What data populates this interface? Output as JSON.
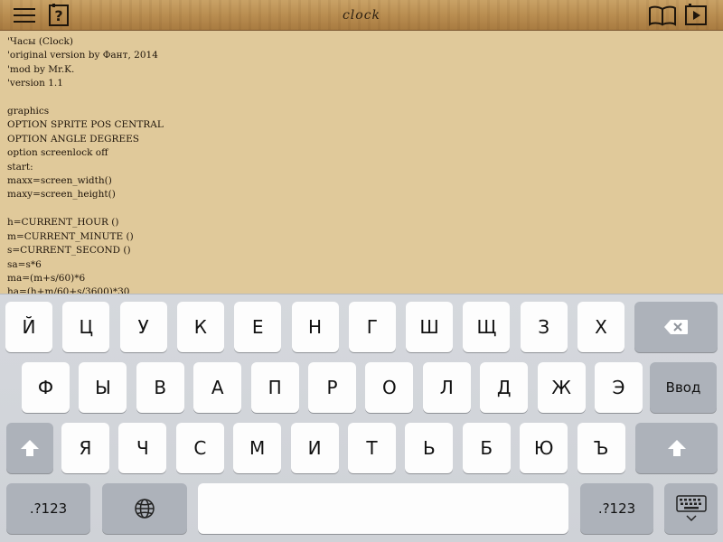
{
  "toolbar": {
    "title": "clock",
    "icons": [
      "menu-icon",
      "help-icon",
      "book-icon",
      "play-icon"
    ],
    "help_glyph": "?"
  },
  "editor": {
    "code": "'Часы (Clock)\n'original version by Фант, 2014\n'mod by Mr.K.\n'version 1.1\n\ngraphics\nOPTION SPRITE POS CENTRAL\nOPTION ANGLE DEGREES\noption screenlock off\nstart:\nmaxx=screen_width()\nmaxy=screen_height()\n\nh=CURRENT_HOUR ()\nm=CURRENT_MINUTE ()\ns=CURRENT_SECOND ()\nsa=s*6\nma=(m+s/60)*6\nha=(h+m/60+s/3600)*30"
  },
  "keyboard": {
    "row1": [
      "Й",
      "Ц",
      "У",
      "К",
      "Е",
      "Н",
      "Г",
      "Ш",
      "Щ",
      "З",
      "Х"
    ],
    "row2": [
      "Ф",
      "Ы",
      "В",
      "А",
      "П",
      "Р",
      "О",
      "Л",
      "Д",
      "Ж",
      "Э"
    ],
    "row3": [
      "Я",
      "Ч",
      "С",
      "М",
      "И",
      "Т",
      "Ь",
      "Б",
      "Ю",
      "Ъ"
    ],
    "enter_label": "Ввод",
    "numbers_label": ".?123",
    "icons": [
      "backspace-icon",
      "shift-icon",
      "globe-icon",
      "keyboard-hide-icon"
    ]
  },
  "colors": {
    "wood": "#b88c4f",
    "paper": "#e0c99a",
    "key_light": "#fdfdfd",
    "key_dark": "#adb2ba"
  }
}
